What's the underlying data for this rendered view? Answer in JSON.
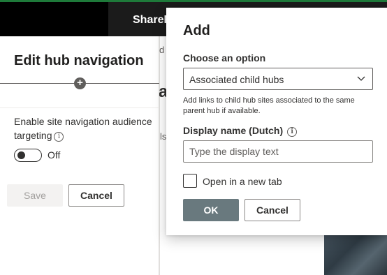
{
  "suite_bar": {
    "brand_text": "ShareP",
    "accent_color": "#1e7a3a"
  },
  "background_page": {
    "letter_d": "d",
    "letter_a": "a",
    "text_ls": "ls"
  },
  "edit_panel": {
    "title": "Edit hub navigation",
    "add_icon": "plus-circle-icon",
    "targeting_label": "Enable site navigation audience targeting",
    "info_icon": "info-icon",
    "toggle_state": "Off",
    "save_label": "Save",
    "cancel_label": "Cancel"
  },
  "dialog": {
    "title": "Add",
    "choose_label": "Choose an option",
    "selected_option": "Associated child hubs",
    "dropdown_icon": "chevron-down-icon",
    "help_text": "Add links to child hub sites associated to the same parent hub if available.",
    "display_name_label": "Display name (Dutch)",
    "display_name_info_icon": "info-icon",
    "display_name_placeholder": "Type the display text",
    "display_name_value": "",
    "new_tab_label": "Open in a new tab",
    "new_tab_checked": false,
    "ok_label": "OK",
    "cancel_label": "Cancel",
    "ok_color": "#69797e"
  }
}
